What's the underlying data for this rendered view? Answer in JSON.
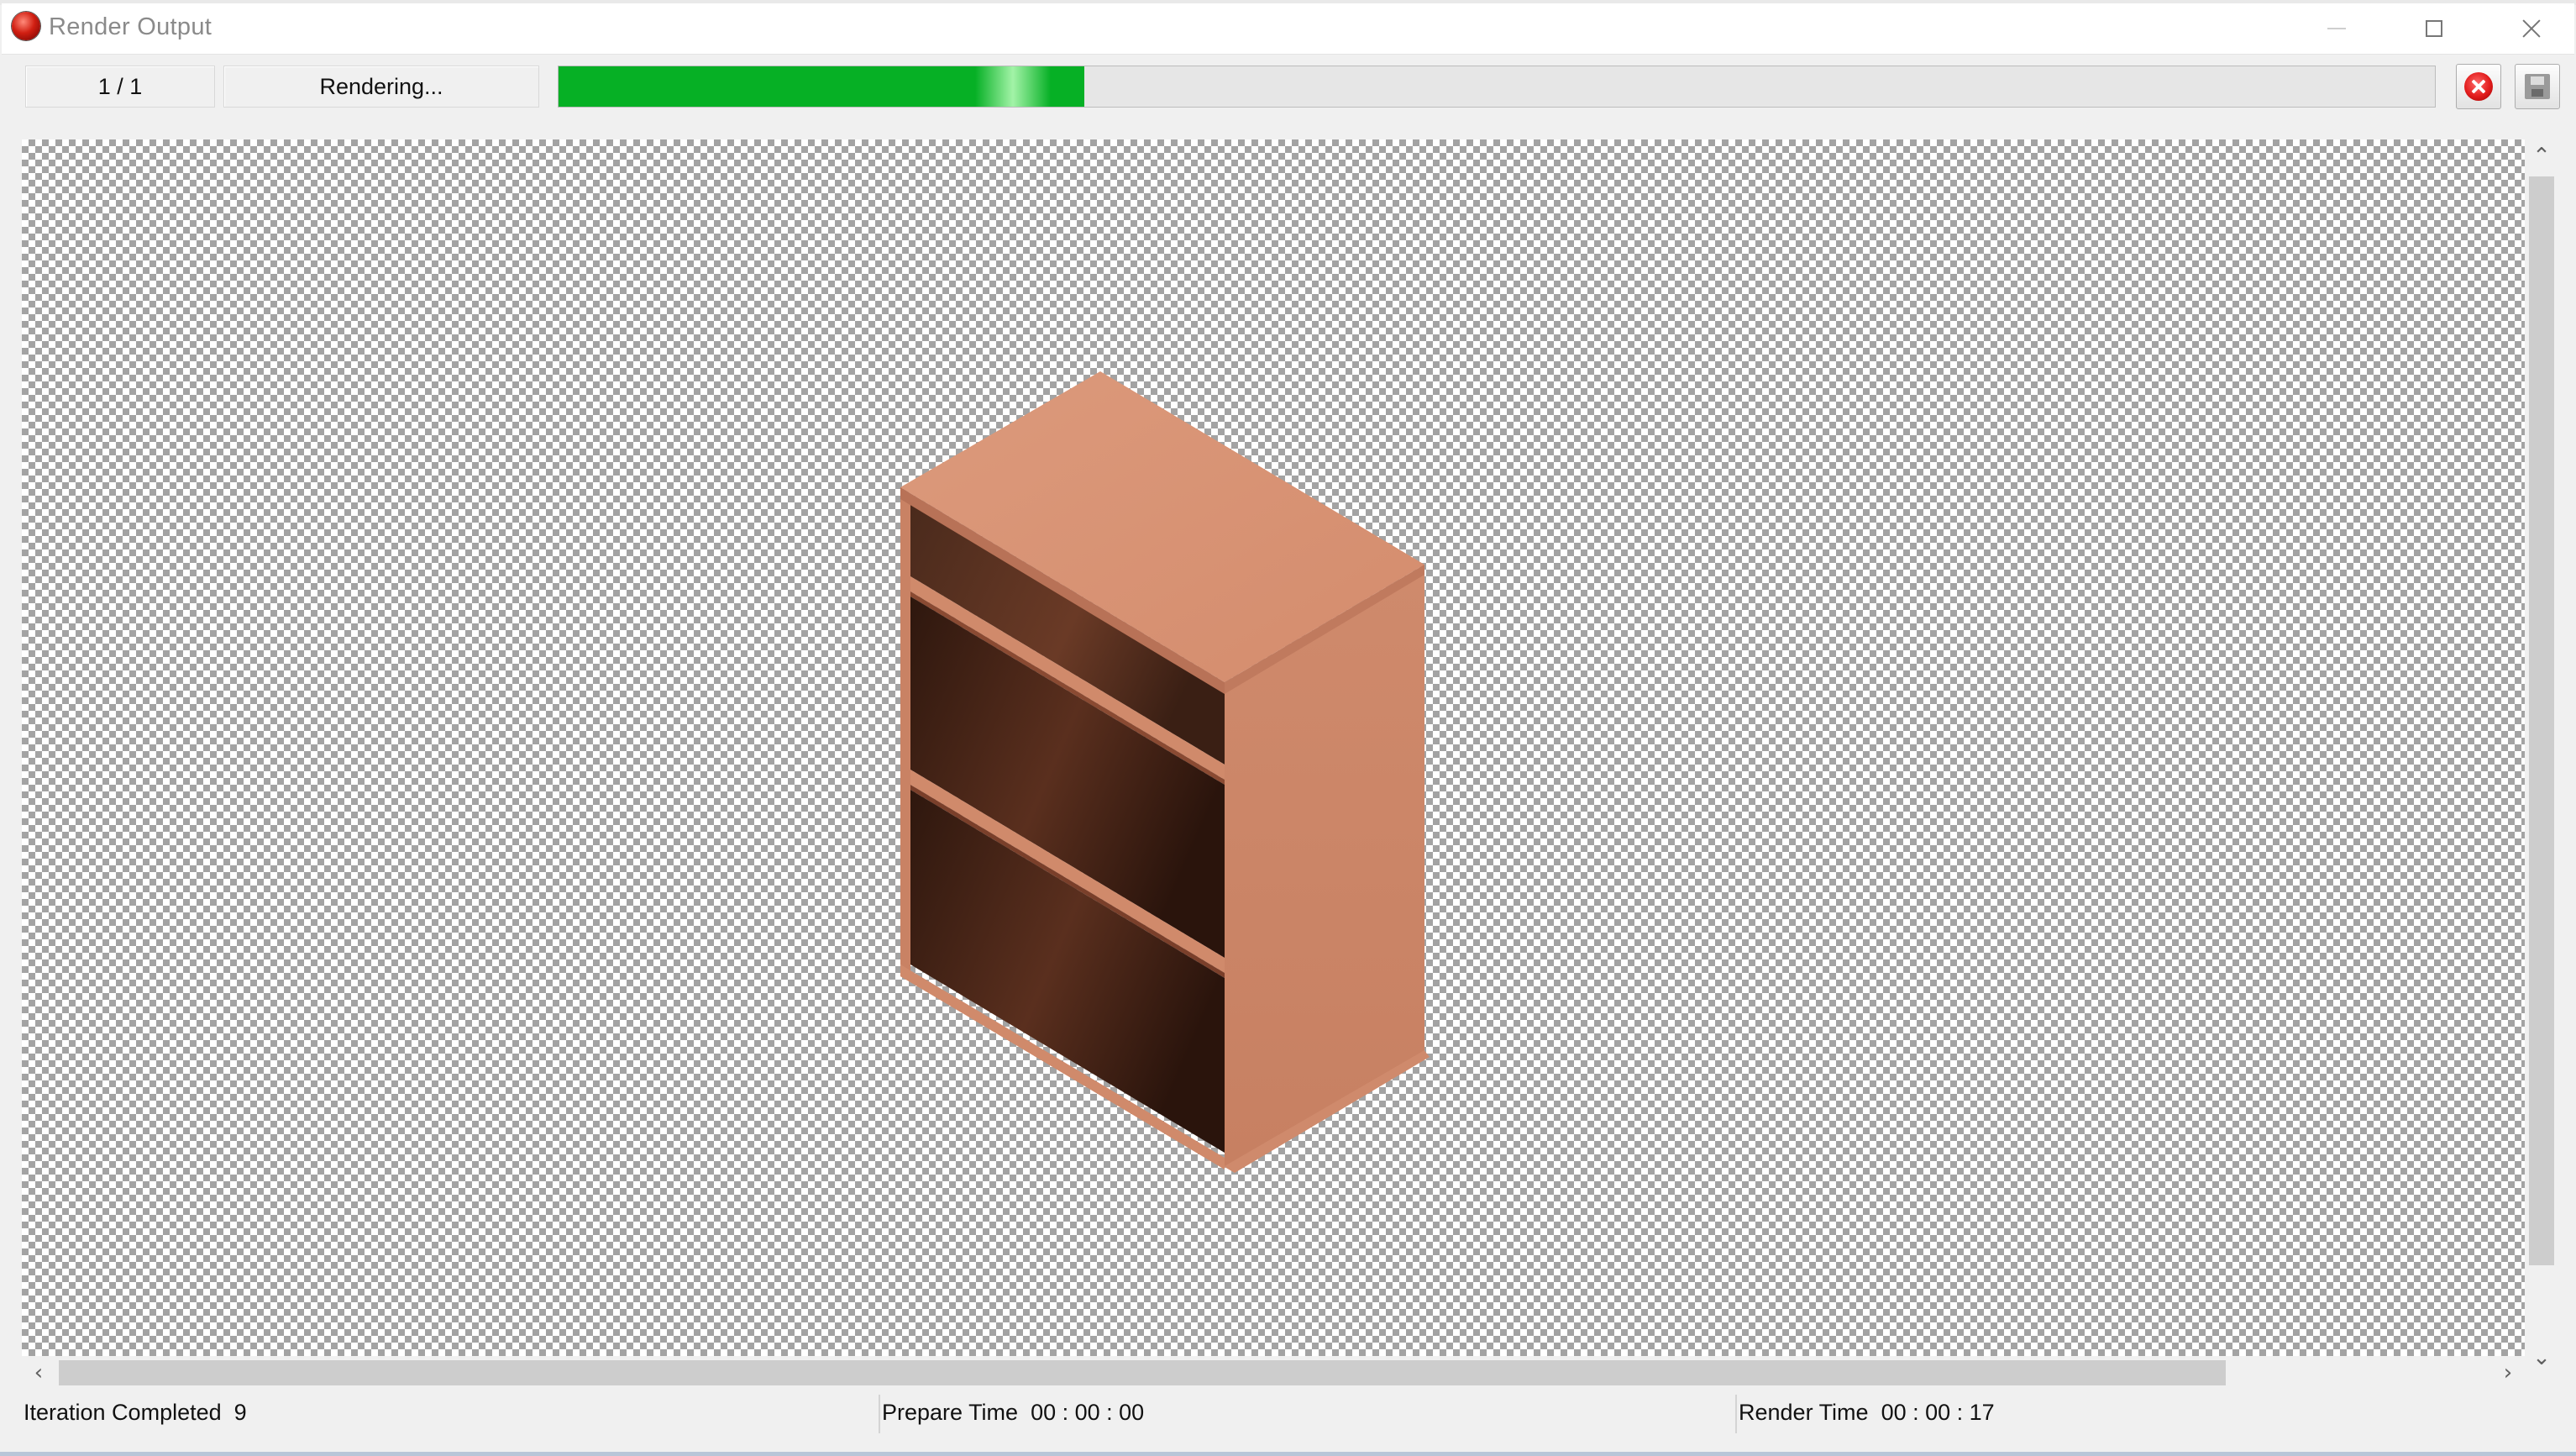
{
  "window": {
    "title": "Render Output",
    "controls": [
      "minimize-icon",
      "maximize-icon",
      "close-icon"
    ]
  },
  "toolbar": {
    "image_count": "1 / 1",
    "status": "Rendering...",
    "progress_fraction": 0.28,
    "progress_color": "#06b025",
    "stop_button_icon": "stop-render-icon",
    "save_button_icon": "save-icon"
  },
  "viewport": {
    "background": "transparency-checkerboard",
    "subject": "bookshelf-render",
    "wood_colors": {
      "top": "#d99274",
      "side": "#c98264",
      "interior_dark": "#3a1f14",
      "shelf_edge": "#d08a6b"
    }
  },
  "statusbar": {
    "iteration_label": "Iteration Completed",
    "iteration_value": "9",
    "prepare_label": "Prepare Time",
    "prepare_value": "00 : 00 : 00",
    "render_label": "Render Time",
    "render_value": "00 : 00 : 17"
  }
}
